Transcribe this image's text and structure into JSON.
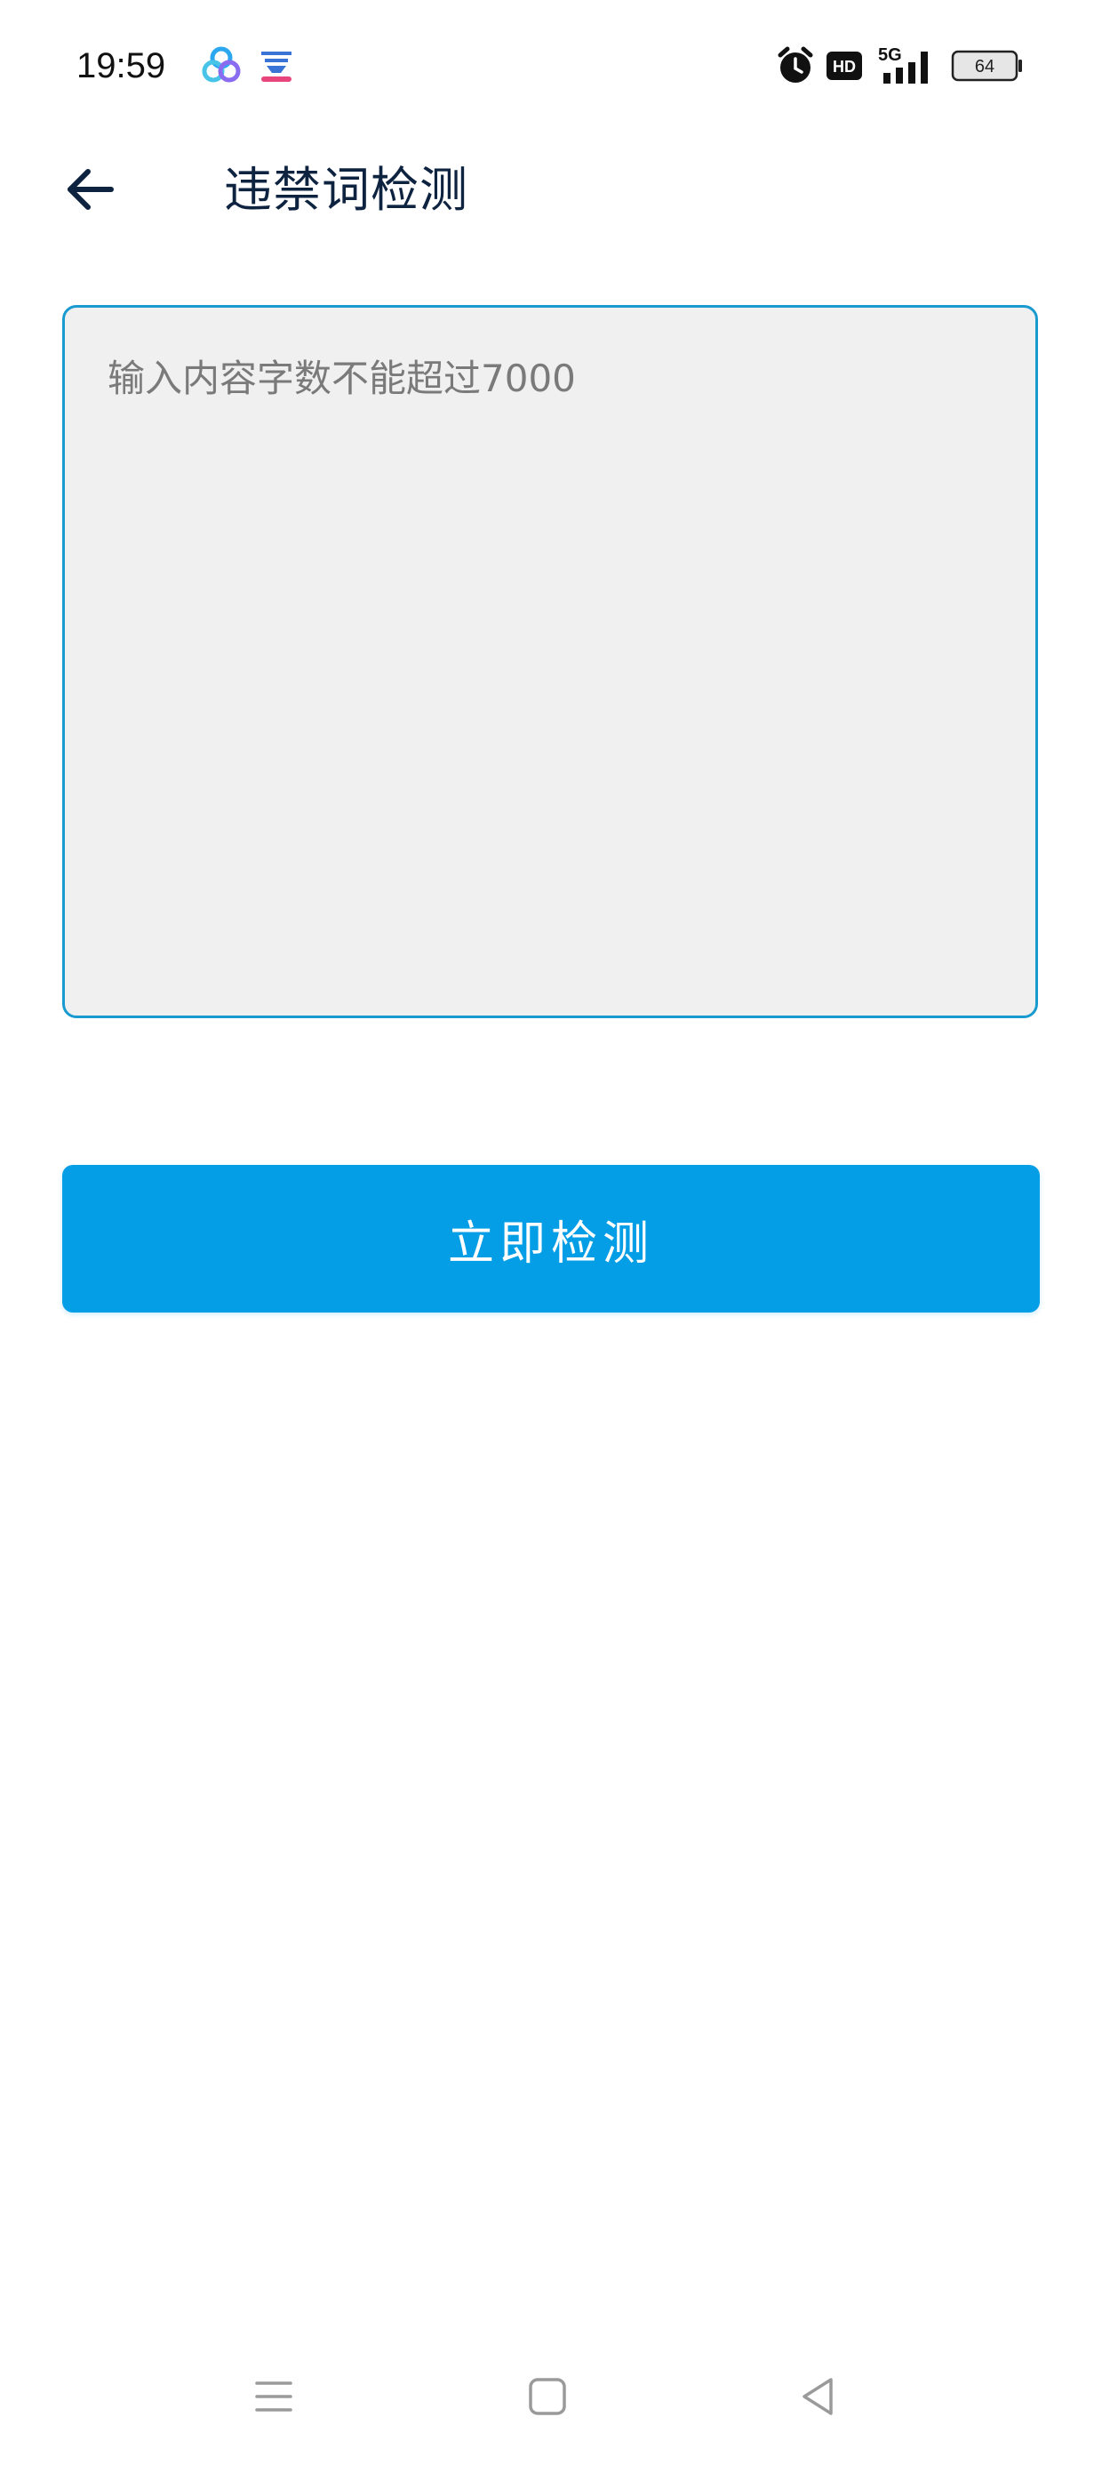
{
  "status_bar": {
    "time": "19:59",
    "app_icons": [
      "cloud-app-icon",
      "yun-app-icon"
    ],
    "indicators": {
      "alarm": "alarm-icon",
      "hd": "HD",
      "network": "5G",
      "battery": "64"
    }
  },
  "header": {
    "back_icon": "arrow-left-icon",
    "title": "违禁词检测"
  },
  "content_input": {
    "value": "",
    "placeholder": "输入内容字数不能超过7000"
  },
  "primary_action": {
    "label": "立即检测"
  },
  "nav_bar": {
    "items": [
      "menu-icon",
      "home-icon",
      "back-icon"
    ]
  },
  "colors": {
    "accent": "#049ee6",
    "border": "#1a9bd0",
    "title": "#0d2340",
    "input_bg": "#f0f0f0"
  }
}
